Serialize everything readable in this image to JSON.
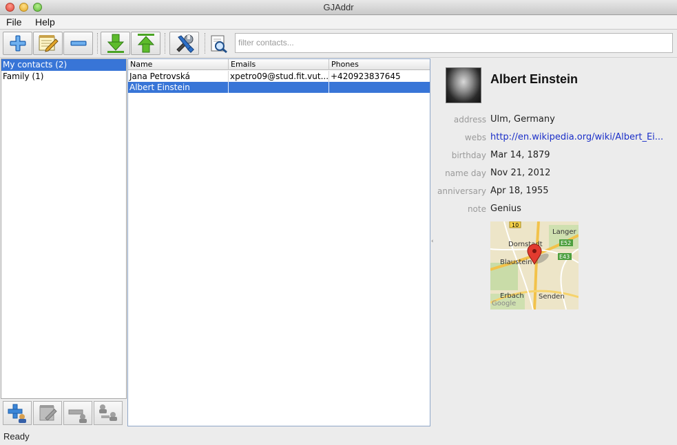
{
  "window": {
    "title": "GJAddr"
  },
  "menu": {
    "items": [
      "File",
      "Help"
    ]
  },
  "toolbar": {
    "buttons": [
      "add-contact-icon",
      "edit-contact-icon",
      "remove-contact-icon",
      "import-icon",
      "export-icon",
      "preferences-icon"
    ],
    "filter_icon": "search-icon",
    "filter_placeholder": "filter contacts..."
  },
  "groups": {
    "items": [
      {
        "label": "My contacts (2)",
        "selected": true
      },
      {
        "label": "Family (1)",
        "selected": false
      }
    ],
    "buttons": [
      "add-group-icon",
      "edit-group-icon",
      "remove-group-icon",
      "merge-group-icon"
    ]
  },
  "contacts": {
    "columns": [
      "Name",
      "Emails",
      "Phones"
    ],
    "rows": [
      {
        "name": "Jana Petrovská",
        "emails": "xpetro09@stud.fit.vut...",
        "phones": "+420923837645",
        "selected": false
      },
      {
        "name": "Albert Einstein",
        "emails": "",
        "phones": "",
        "selected": true
      }
    ]
  },
  "detail": {
    "name": "Albert Einstein",
    "fields": [
      {
        "label": "address",
        "value": "Ulm, Germany",
        "link": false
      },
      {
        "label": "webs",
        "value": "http://en.wikipedia.org/wiki/Albert_Ei...",
        "link": true
      },
      {
        "label": "birthday",
        "value": "Mar 14, 1879",
        "link": false
      },
      {
        "label": "name day",
        "value": "Nov 21, 2012",
        "link": false
      },
      {
        "label": "anniversary",
        "value": "Apr 18, 1955",
        "link": false
      },
      {
        "label": "note",
        "value": "Genius",
        "link": false
      }
    ],
    "map": {
      "labels": [
        "10",
        "Langer",
        "Dornstadt",
        "E52",
        "Blaustein",
        "E43",
        "Erbach",
        "Senden",
        "Google"
      ]
    }
  },
  "status": {
    "text": "Ready"
  },
  "colors": {
    "selection": "#3875d7",
    "link": "#1a2ec8"
  }
}
